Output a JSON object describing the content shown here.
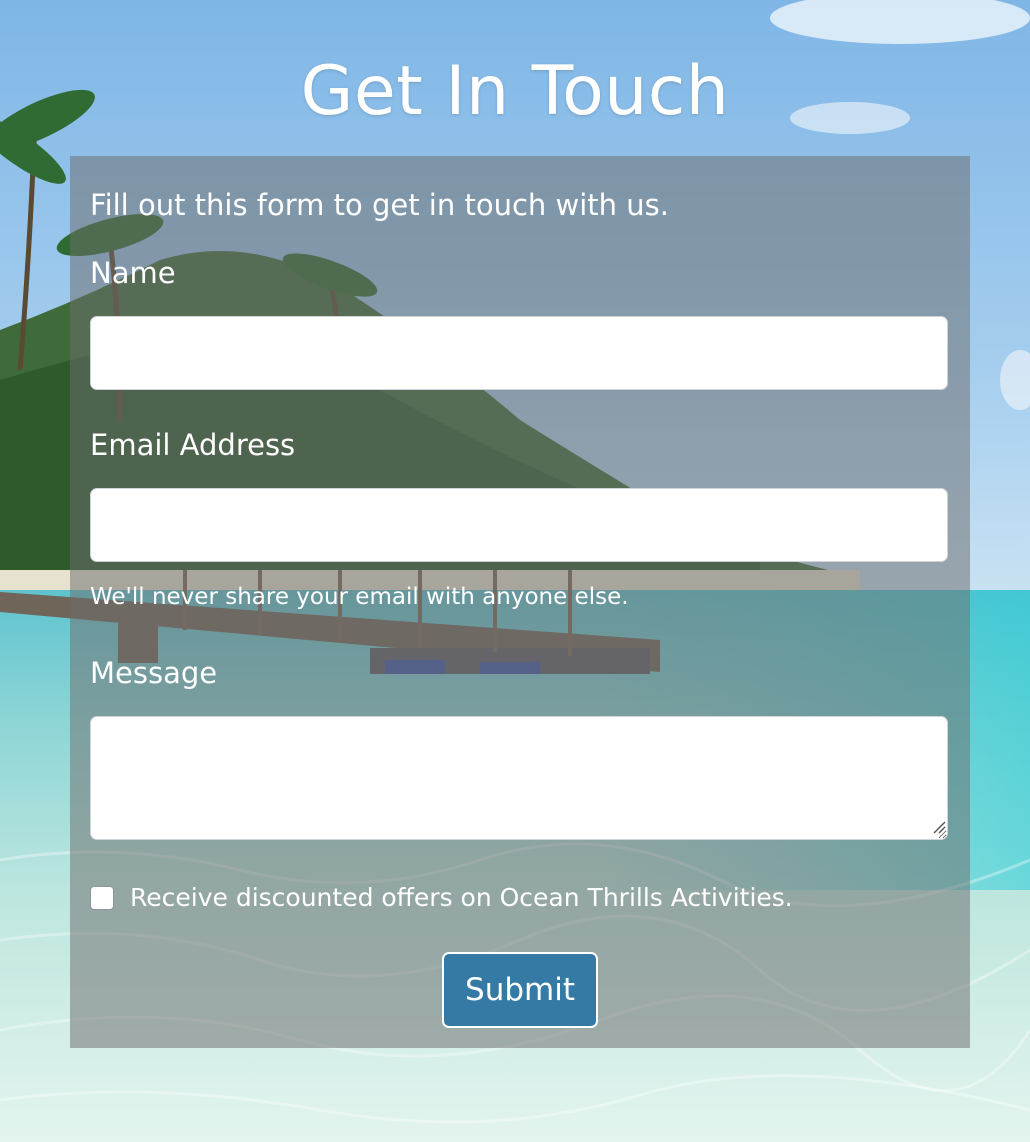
{
  "page": {
    "title": "Get In Touch"
  },
  "form": {
    "intro": "Fill out this form to get in touch with us.",
    "name_label": "Name",
    "name_value": "",
    "email_label": "Email Address",
    "email_value": "",
    "email_help": "We'll never share your email with anyone else.",
    "message_label": "Message",
    "message_value": "",
    "offers_label": "Receive discounted offers on Ocean Thrills Activities.",
    "offers_checked": false,
    "submit_label": "Submit"
  },
  "colors": {
    "accent": "#347aa5",
    "panel_overlay": "rgba(110,110,110,0.52)",
    "text": "#ffffff"
  }
}
